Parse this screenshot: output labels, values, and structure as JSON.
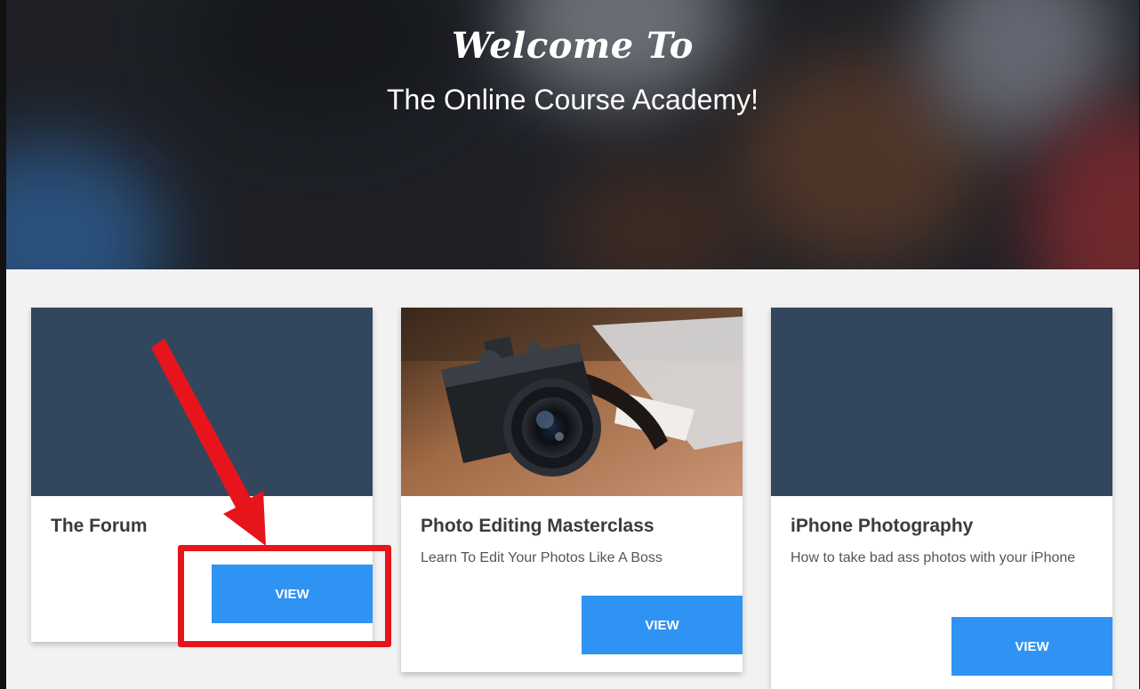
{
  "hero": {
    "title": "Welcome To",
    "subtitle": "The Online Course Academy!"
  },
  "cards": [
    {
      "title": "The Forum",
      "description": "",
      "image": "solid-slate",
      "button_label": "VIEW"
    },
    {
      "title": "Photo Editing Masterclass",
      "description": "Learn To Edit Your Photos Like A Boss",
      "image": "camera-photo",
      "button_label": "VIEW"
    },
    {
      "title": "iPhone Photography",
      "description": "How to take bad ass photos with your iPhone",
      "image": "solid-slate",
      "button_label": "VIEW"
    }
  ],
  "colors": {
    "accent": "#2f93f3",
    "card_placeholder": "#32475e",
    "annotation": "#e8141c",
    "page_bg": "#f2f2f2"
  }
}
